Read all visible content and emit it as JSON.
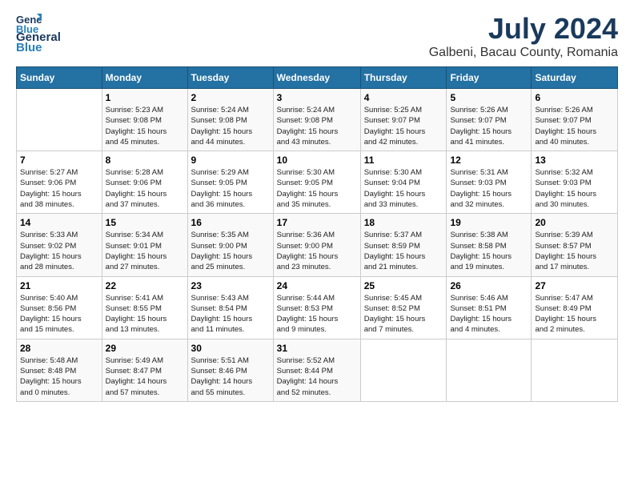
{
  "header": {
    "logo_line1": "General",
    "logo_line2": "Blue",
    "title": "July 2024",
    "subtitle": "Galbeni, Bacau County, Romania"
  },
  "days_of_week": [
    "Sunday",
    "Monday",
    "Tuesday",
    "Wednesday",
    "Thursday",
    "Friday",
    "Saturday"
  ],
  "weeks": [
    [
      {
        "day": "",
        "info": ""
      },
      {
        "day": "1",
        "info": "Sunrise: 5:23 AM\nSunset: 9:08 PM\nDaylight: 15 hours\nand 45 minutes."
      },
      {
        "day": "2",
        "info": "Sunrise: 5:24 AM\nSunset: 9:08 PM\nDaylight: 15 hours\nand 44 minutes."
      },
      {
        "day": "3",
        "info": "Sunrise: 5:24 AM\nSunset: 9:08 PM\nDaylight: 15 hours\nand 43 minutes."
      },
      {
        "day": "4",
        "info": "Sunrise: 5:25 AM\nSunset: 9:07 PM\nDaylight: 15 hours\nand 42 minutes."
      },
      {
        "day": "5",
        "info": "Sunrise: 5:26 AM\nSunset: 9:07 PM\nDaylight: 15 hours\nand 41 minutes."
      },
      {
        "day": "6",
        "info": "Sunrise: 5:26 AM\nSunset: 9:07 PM\nDaylight: 15 hours\nand 40 minutes."
      }
    ],
    [
      {
        "day": "7",
        "info": "Sunrise: 5:27 AM\nSunset: 9:06 PM\nDaylight: 15 hours\nand 38 minutes."
      },
      {
        "day": "8",
        "info": "Sunrise: 5:28 AM\nSunset: 9:06 PM\nDaylight: 15 hours\nand 37 minutes."
      },
      {
        "day": "9",
        "info": "Sunrise: 5:29 AM\nSunset: 9:05 PM\nDaylight: 15 hours\nand 36 minutes."
      },
      {
        "day": "10",
        "info": "Sunrise: 5:30 AM\nSunset: 9:05 PM\nDaylight: 15 hours\nand 35 minutes."
      },
      {
        "day": "11",
        "info": "Sunrise: 5:30 AM\nSunset: 9:04 PM\nDaylight: 15 hours\nand 33 minutes."
      },
      {
        "day": "12",
        "info": "Sunrise: 5:31 AM\nSunset: 9:03 PM\nDaylight: 15 hours\nand 32 minutes."
      },
      {
        "day": "13",
        "info": "Sunrise: 5:32 AM\nSunset: 9:03 PM\nDaylight: 15 hours\nand 30 minutes."
      }
    ],
    [
      {
        "day": "14",
        "info": "Sunrise: 5:33 AM\nSunset: 9:02 PM\nDaylight: 15 hours\nand 28 minutes."
      },
      {
        "day": "15",
        "info": "Sunrise: 5:34 AM\nSunset: 9:01 PM\nDaylight: 15 hours\nand 27 minutes."
      },
      {
        "day": "16",
        "info": "Sunrise: 5:35 AM\nSunset: 9:00 PM\nDaylight: 15 hours\nand 25 minutes."
      },
      {
        "day": "17",
        "info": "Sunrise: 5:36 AM\nSunset: 9:00 PM\nDaylight: 15 hours\nand 23 minutes."
      },
      {
        "day": "18",
        "info": "Sunrise: 5:37 AM\nSunset: 8:59 PM\nDaylight: 15 hours\nand 21 minutes."
      },
      {
        "day": "19",
        "info": "Sunrise: 5:38 AM\nSunset: 8:58 PM\nDaylight: 15 hours\nand 19 minutes."
      },
      {
        "day": "20",
        "info": "Sunrise: 5:39 AM\nSunset: 8:57 PM\nDaylight: 15 hours\nand 17 minutes."
      }
    ],
    [
      {
        "day": "21",
        "info": "Sunrise: 5:40 AM\nSunset: 8:56 PM\nDaylight: 15 hours\nand 15 minutes."
      },
      {
        "day": "22",
        "info": "Sunrise: 5:41 AM\nSunset: 8:55 PM\nDaylight: 15 hours\nand 13 minutes."
      },
      {
        "day": "23",
        "info": "Sunrise: 5:43 AM\nSunset: 8:54 PM\nDaylight: 15 hours\nand 11 minutes."
      },
      {
        "day": "24",
        "info": "Sunrise: 5:44 AM\nSunset: 8:53 PM\nDaylight: 15 hours\nand 9 minutes."
      },
      {
        "day": "25",
        "info": "Sunrise: 5:45 AM\nSunset: 8:52 PM\nDaylight: 15 hours\nand 7 minutes."
      },
      {
        "day": "26",
        "info": "Sunrise: 5:46 AM\nSunset: 8:51 PM\nDaylight: 15 hours\nand 4 minutes."
      },
      {
        "day": "27",
        "info": "Sunrise: 5:47 AM\nSunset: 8:49 PM\nDaylight: 15 hours\nand 2 minutes."
      }
    ],
    [
      {
        "day": "28",
        "info": "Sunrise: 5:48 AM\nSunset: 8:48 PM\nDaylight: 15 hours\nand 0 minutes."
      },
      {
        "day": "29",
        "info": "Sunrise: 5:49 AM\nSunset: 8:47 PM\nDaylight: 14 hours\nand 57 minutes."
      },
      {
        "day": "30",
        "info": "Sunrise: 5:51 AM\nSunset: 8:46 PM\nDaylight: 14 hours\nand 55 minutes."
      },
      {
        "day": "31",
        "info": "Sunrise: 5:52 AM\nSunset: 8:44 PM\nDaylight: 14 hours\nand 52 minutes."
      },
      {
        "day": "",
        "info": ""
      },
      {
        "day": "",
        "info": ""
      },
      {
        "day": "",
        "info": ""
      }
    ]
  ]
}
